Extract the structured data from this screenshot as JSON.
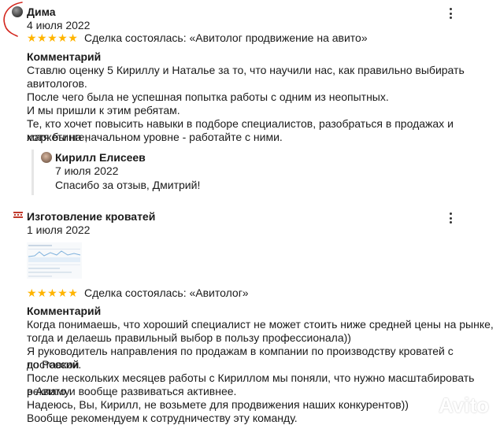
{
  "review1": {
    "author": "Дима",
    "date": "4 июля 2022",
    "stars": "★★★★★",
    "deal": "Сделка состоялась: «Авитолог продвижение на авито»",
    "comment_heading": "Комментарий",
    "lines": [
      "Ставлю оценку 5 Кириллу и Наталье за то, что научили нас, как правильно выбирать",
      "авитологов.",
      "После чего была не успешная попытка работы с одним из неопытных.",
      "И мы пришли к этим ребятам.",
      "Те, кто хочет повысить навыки в подборе специалистов, разобраться в продажах и маркетинге,",
      "хотя бы на начальном уровне - работайте с ними."
    ],
    "reply": {
      "author": "Кирилл Елисеев",
      "date": "7 июля 2022",
      "text": "Спасибо за отзыв, Дмитрий!"
    }
  },
  "review2": {
    "author": "Изготовление кроватей",
    "date": "1 июля 2022",
    "stars": "★★★★★",
    "deal": "Сделка состоялась: «Авитолог»",
    "comment_heading": "Комментарий",
    "lines": [
      "Когда понимаешь, что хороший специалист не может стоить ниже средней цены на рынке,",
      "тогда и делаешь правильный выбор в пользу профессионала))",
      "Я руководитель направления по продажам в компании по производству кроватей с доставкой",
      "по России.",
      "После нескольких месяцев работы с Кириллом мы поняли, что нужно масштабировать рекламу",
      "в Авито и вообще развиваться активнее.",
      "Надеюсь, Вы, Кирилл, не возьмете для продвижения наших конкурентов))",
      "Вообще рекомендуем к сотрудничеству эту команду."
    ]
  },
  "watermark": "Avito",
  "colors": {
    "star": "#ffb400",
    "annotation": "#d3261d"
  }
}
